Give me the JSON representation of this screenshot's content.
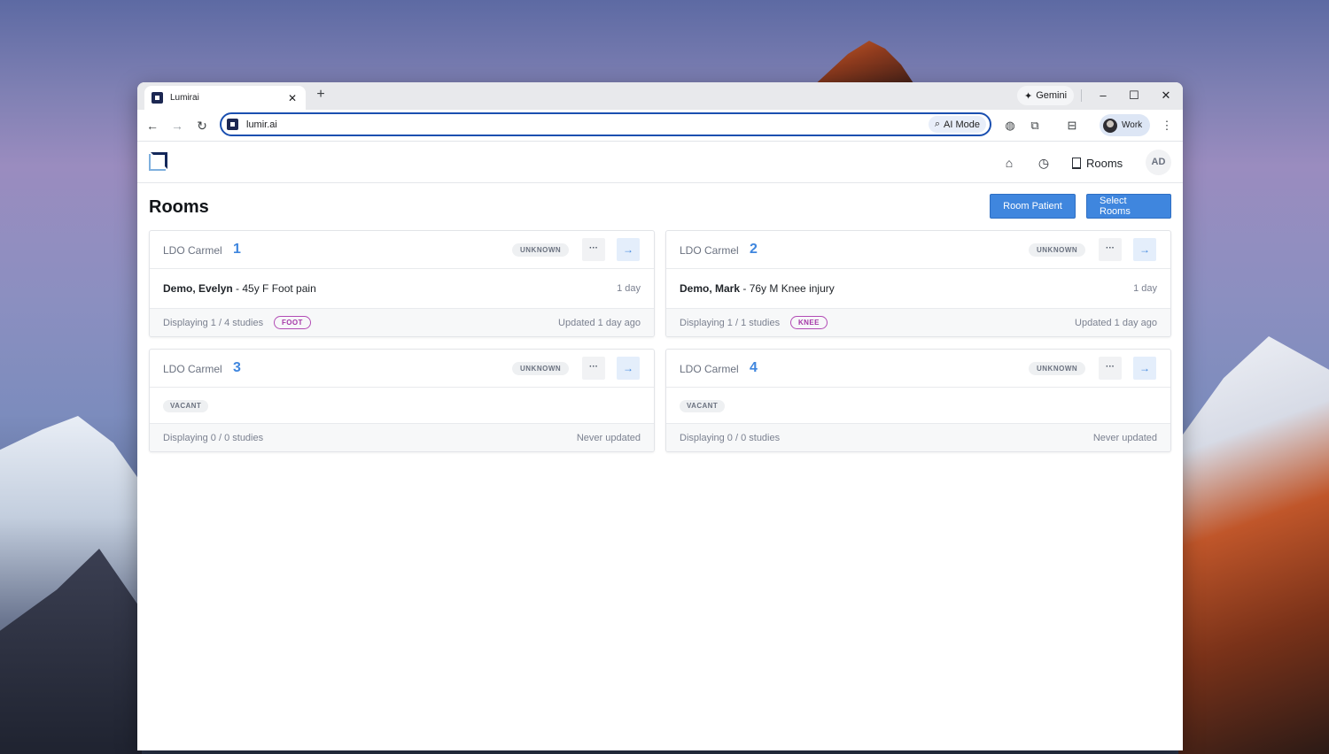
{
  "browser": {
    "tab_title": "Lumirai",
    "tab_close": "✕",
    "new_tab": "+",
    "gemini_label": "Gemini",
    "url": "lumir.ai",
    "ai_mode_label": "AI Mode",
    "profile_label": "Work"
  },
  "app": {
    "nav": {
      "rooms_label": "Rooms",
      "avatar_initials": "AD"
    }
  },
  "page": {
    "title": "Rooms",
    "buttons": {
      "room_patient": "Room Patient",
      "select_rooms": "Select Rooms"
    }
  },
  "rooms": [
    {
      "location": "LDO Carmel",
      "number": "1",
      "status": "UNKNOWN",
      "patient_name": "Demo, Evelyn",
      "patient_detail": " - 45y F Foot pain",
      "duration": "1 day",
      "displaying": "Displaying 1 / 4 studies",
      "tag": "FOOT",
      "updated": "Updated 1 day ago"
    },
    {
      "location": "LDO Carmel",
      "number": "2",
      "status": "UNKNOWN",
      "patient_name": "Demo, Mark",
      "patient_detail": " - 76y M Knee injury",
      "duration": "1 day",
      "displaying": "Displaying 1 / 1 studies",
      "tag": "KNEE",
      "updated": "Updated 1 day ago"
    },
    {
      "location": "LDO Carmel",
      "number": "3",
      "status": "UNKNOWN",
      "occupancy": "VACANT",
      "displaying": "Displaying 0 / 0 studies",
      "updated": "Never updated"
    },
    {
      "location": "LDO Carmel",
      "number": "4",
      "status": "UNKNOWN",
      "occupancy": "VACANT",
      "displaying": "Displaying 0 / 0 studies",
      "updated": "Never updated"
    }
  ],
  "colors": {
    "accent": "#3f86de",
    "tag": "#a437a7",
    "logo_dark": "#14285a",
    "logo_light": "#7fb0de"
  }
}
